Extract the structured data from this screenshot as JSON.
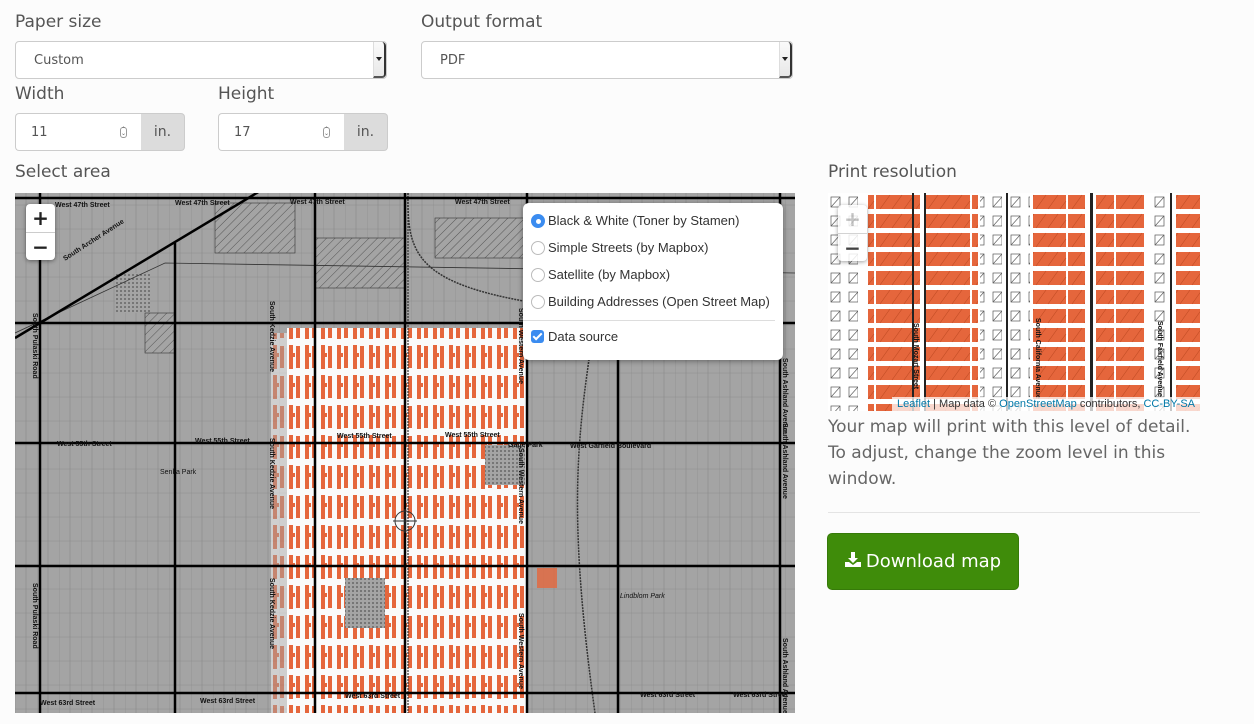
{
  "paper_size": {
    "label": "Paper size",
    "value": "Custom"
  },
  "output_format": {
    "label": "Output format",
    "value": "PDF"
  },
  "width": {
    "label": "Width",
    "value": "11",
    "unit": "in."
  },
  "height": {
    "label": "Height",
    "value": "17",
    "unit": "in."
  },
  "select_area": {
    "label": "Select area",
    "zoom_in": "+",
    "zoom_out": "−",
    "layers": [
      {
        "label": "Black & White (Toner by Stamen)",
        "selected": true
      },
      {
        "label": "Simple Streets (by Mapbox)",
        "selected": false
      },
      {
        "label": "Satellite (by Mapbox)",
        "selected": false
      },
      {
        "label": "Building Addresses (Open Street Map)",
        "selected": false
      }
    ],
    "overlay": {
      "label": "Data source",
      "checked": true
    },
    "streets": {
      "w47_a": "West 47th Street",
      "w47_b": "West 47th Street",
      "w47_c": "West 47th Street",
      "w47_d": "West 47th Street",
      "archer": "South Archer Avenue",
      "pulaski_a": "South Pulaski Road",
      "pulaski_b": "South Pulaski Road",
      "kedzie_a": "South Kedzie Avenue",
      "kedzie_b": "South Kedzie Avenue",
      "kedzie_c": "South Kedzie Avenue",
      "western_a": "South Western Avenue",
      "western_b": "South Western Avenue",
      "western_c": "South Western Avenue",
      "ashland_a": "South Ashland Avenue",
      "ashland_b": "South Ashland Avenue",
      "ashland_c": "South Ashland Avenue",
      "w55_a": "West 55th Street",
      "w55_b": "West 55th Street",
      "w55_c": "West 55th Street",
      "w55_d": "West 55th Street",
      "garfield": "West Garfield Boulevard",
      "gage": "Gage Park",
      "senka": "Senka Park",
      "lindblom": "Lindblom Park",
      "w63_a": "West 63rd Street",
      "w63_b": "West 63rd Street",
      "w63_c": "West 63rd Street",
      "w63_d": "West 63rd Street",
      "w63_e": "West 63rd Street",
      "boulevard": "Boulevard"
    }
  },
  "print_resolution": {
    "label": "Print resolution",
    "zoom_in": "+",
    "zoom_out": "−",
    "streets": {
      "mozart": "South Mozart Street",
      "california": "South California Avenue",
      "fairfield": "South Fairfield Avenue"
    },
    "attribution": {
      "leaflet": "Leaflet",
      "sep": " | Map data © ",
      "osm": "OpenStreetMap",
      "contrib": " contributors, ",
      "license": "CC-BY-SA"
    },
    "description": "Your map will print with this level of detail. To adjust, change the zoom level in this window."
  },
  "download": {
    "label": "Download map",
    "icon": "download-icon"
  },
  "colors": {
    "accent": "#e5663c",
    "button": "#3f8c0a",
    "radio": "#3b8cf0",
    "link": "#0078a8"
  }
}
